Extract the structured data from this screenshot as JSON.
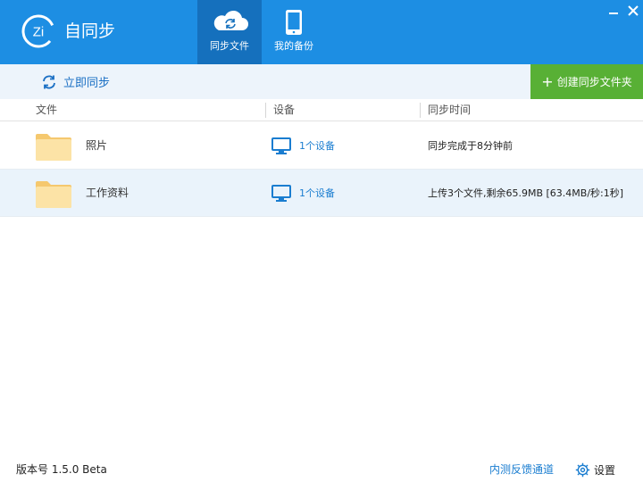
{
  "app": {
    "logo_text": "Zi",
    "title": "自同步"
  },
  "tabs": [
    {
      "label": "同步文件",
      "icon": "cloud-sync-icon",
      "active": true
    },
    {
      "label": "我的备份",
      "icon": "phone-icon",
      "active": false
    }
  ],
  "window_controls": {
    "minimize_icon": "minimize-icon",
    "close_icon": "close-icon"
  },
  "toolbar": {
    "sync_now_label": "立即同步",
    "create_folder_label": "创建同步文件夹",
    "create_folder_icon": "+"
  },
  "table": {
    "columns": [
      "文件",
      "设备",
      "同步时间"
    ],
    "rows": [
      {
        "name": "照片",
        "devices": "1个设备",
        "sync_time": "同步完成于8分钟前",
        "selected": false
      },
      {
        "name": "工作资料",
        "devices": "1个设备",
        "sync_time": "上传3个文件,剩余65.9MB [63.4MB/秒:1秒]",
        "selected": true
      }
    ]
  },
  "footer": {
    "version": "版本号 1.5.0 Beta",
    "feedback": "内测反馈通道",
    "settings": "设置"
  },
  "colors": {
    "header_bg": "#1d8ee3",
    "active_tab_bg": "#1570bd",
    "toolbar_bg": "#edf4fb",
    "create_button_bg": "#58b035",
    "link_blue": "#1a7dd0",
    "folder_yellow": "#fce3a6",
    "selected_row_bg": "#eaf3fb"
  }
}
